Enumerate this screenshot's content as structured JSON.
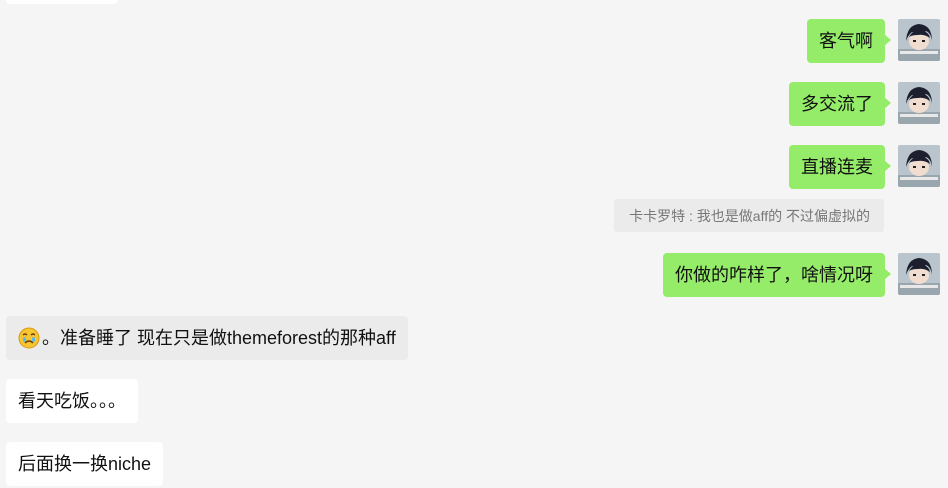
{
  "messages_sent": [
    {
      "text": "客气啊"
    },
    {
      "text": "多交流了"
    },
    {
      "text": "直播连麦"
    },
    {
      "text": "你做的咋样了，啥情况呀"
    }
  ],
  "quoted_message": {
    "text": "卡卡罗特 : 我也是做aff的 不过偏虚拟的"
  },
  "messages_received": [
    {
      "emoji": "crying-face-icon",
      "text": "。准备睡了  现在只是做themeforest的那种aff"
    },
    {
      "text": "看天吃饭。。。"
    },
    {
      "text": "后面换一换niche"
    }
  ],
  "colors": {
    "sent_bubble": "#95ec69",
    "received_bubble": "#ffffff",
    "quote_bubble": "#ebebeb",
    "background": "#f5f5f5"
  }
}
